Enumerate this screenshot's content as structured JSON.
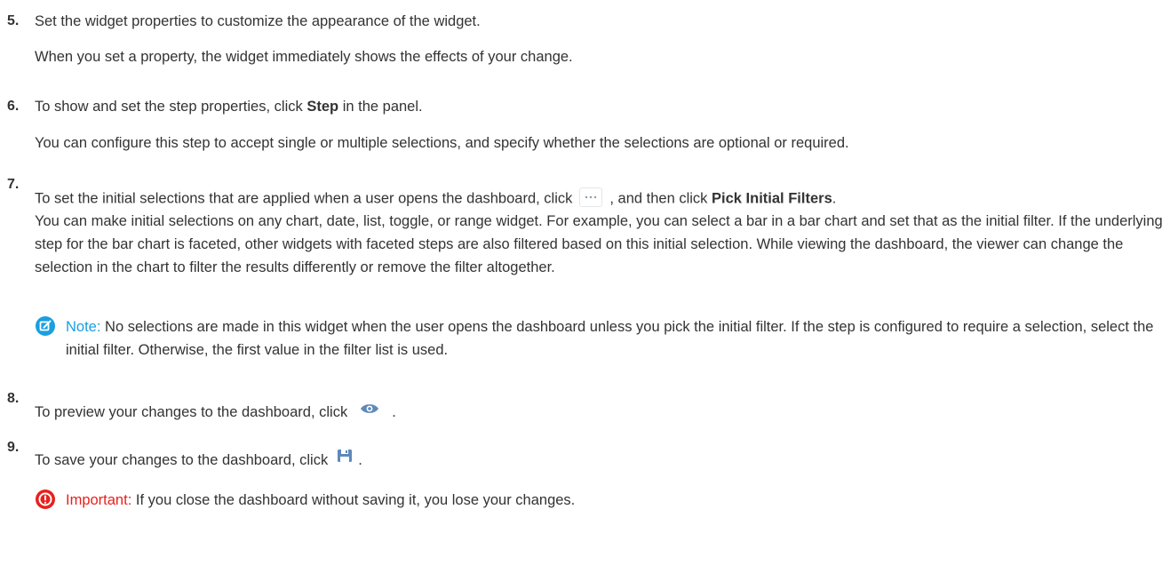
{
  "steps": [
    {
      "number": "5.",
      "text": "Set the widget properties to customize the appearance of the widget.",
      "detail": "When you set a property, the widget immediately shows the effects of your change."
    },
    {
      "number": "6.",
      "text_before": "To show and set the step properties, click",
      "bold": "Step",
      "text_after": "in the panel.",
      "detail": "You can configure this step to accept single or multiple selections, and specify whether the selections are optional or required."
    },
    {
      "number": "7.",
      "text_before": "To set the initial selections that are applied when a user opens the dashboard, click",
      "text_middle": ", and then click",
      "bold": "Pick Initial Filters",
      "text_after": ".",
      "detail": "You can make initial selections on any chart, date, list, toggle, or range widget. For example, you can select a bar in a bar chart and set that as the initial filter. If the underlying step for the bar chart is faceted, other widgets with faceted steps are also filtered based on this initial selection. While viewing the dashboard, the viewer can change the selection in the chart to filter the results differently or remove the filter altogether.",
      "note_label": "Note:",
      "note_text": "No selections are made in this widget when the user opens the dashboard unless you pick the initial filter. If the step is configured to require a selection, select the initial filter. Otherwise, the first value in the filter list is used."
    },
    {
      "number": "8.",
      "text_before": "To preview your changes to the dashboard, click",
      "text_after": "."
    },
    {
      "number": "9.",
      "text_before": "To save your changes to the dashboard, click",
      "text_after": ".",
      "important_label": "Important:",
      "important_text": "If you close the dashboard without saving it, you lose your changes."
    }
  ],
  "icons": {
    "more": "more-options-icon",
    "preview": "eye-icon",
    "save": "save-icon",
    "note": "note-edit-icon",
    "important": "important-exclamation-icon"
  },
  "colors": {
    "text": "#333333",
    "note": "#1a9fe0",
    "important": "#e8201d",
    "icon_blue": "#5f89b8"
  }
}
